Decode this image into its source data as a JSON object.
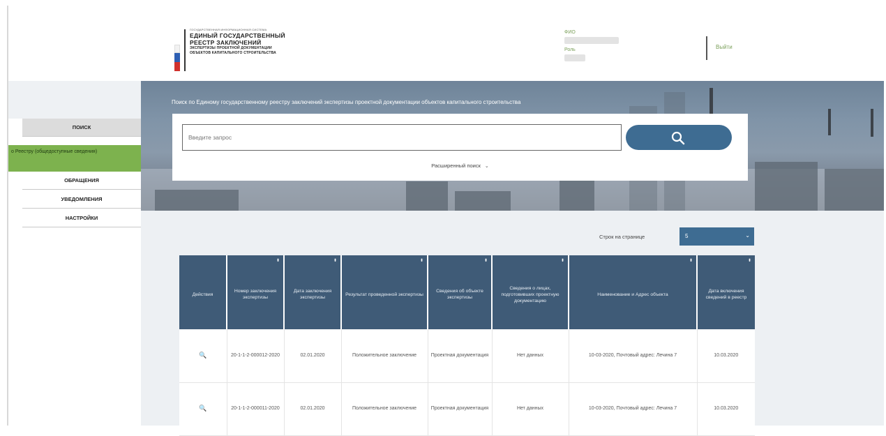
{
  "header": {
    "logo": {
      "line_small": "ГОСУДАРСТВЕННАЯ ИНФОРМАЦИОННАЯ СИСТЕМА",
      "line1": "ЕДИНЫЙ ГОСУДАРСТВЕННЫЙ",
      "line2": "РЕЕСТР ЗАКЛЮЧЕНИЙ",
      "line3": "ЭКСПЕРТИЗЫ ПРОЕКТНОЙ ДОКУМЕНТАЦИИ",
      "line4": "ОБЪЕКТОВ КАПИТАЛЬНОГО СТРОИТЕЛЬСТВА"
    },
    "user": {
      "fio_label": "ФИО",
      "role_label": "Роль"
    },
    "logout_label": "Выйти"
  },
  "sidebar": {
    "items": [
      {
        "label": "ПОИСК"
      },
      {
        "label": "ОБРАЩЕНИЯ"
      },
      {
        "label": "УВЕДОМЛЕНИЯ"
      },
      {
        "label": "НАСТРОЙКИ"
      }
    ],
    "sub_item": "о Реестру (общедоступные сведения)"
  },
  "search": {
    "title": "Поиск по Единому государственному реестру заключений экспертизы проектной документации объектов капитального строительства",
    "placeholder": "Введите запрос",
    "advanced_label": "Расширенный поиск",
    "advanced_chevron": "⌄"
  },
  "pagination": {
    "rows_label": "Строк на странице",
    "rows_value": "5",
    "chevron": "⌄"
  },
  "table": {
    "headers": [
      "Действия",
      "Номер заключения экспертизы",
      "Дата заключения экспертизы",
      "Результат проведенной экспертизы",
      "Сведения об объекте экспертизы",
      "Сведения о лицах, подготовивших проектную документацию",
      "Наименование и Адрес объекта",
      "Дата включения сведений в реестр"
    ],
    "sort_icon": "⬍",
    "rows": [
      {
        "action_icon": "🔍",
        "number": "20-1-1-2-000012-2020",
        "date": "02.01.2020",
        "result": "Положительное заключение",
        "object": "Проектная документация",
        "persons": "Нет данных",
        "name_address": "10-03-2020, Почтовый адрес: Лечина 7",
        "included": "10.03.2020"
      },
      {
        "action_icon": "🔍",
        "number": "20-1-1-2-000011-2020",
        "date": "02.01.2020",
        "result": "Положительное заключение",
        "object": "Проектная документация",
        "persons": "Нет данных",
        "name_address": "10-03-2020, Почтовый адрес: Лечина 7",
        "included": "10.03.2020"
      }
    ]
  },
  "colors": {
    "accent": "#3e6c92",
    "table_header": "#3f5b77",
    "active_nav": "#7db24e",
    "link_green": "#7ba05b"
  }
}
